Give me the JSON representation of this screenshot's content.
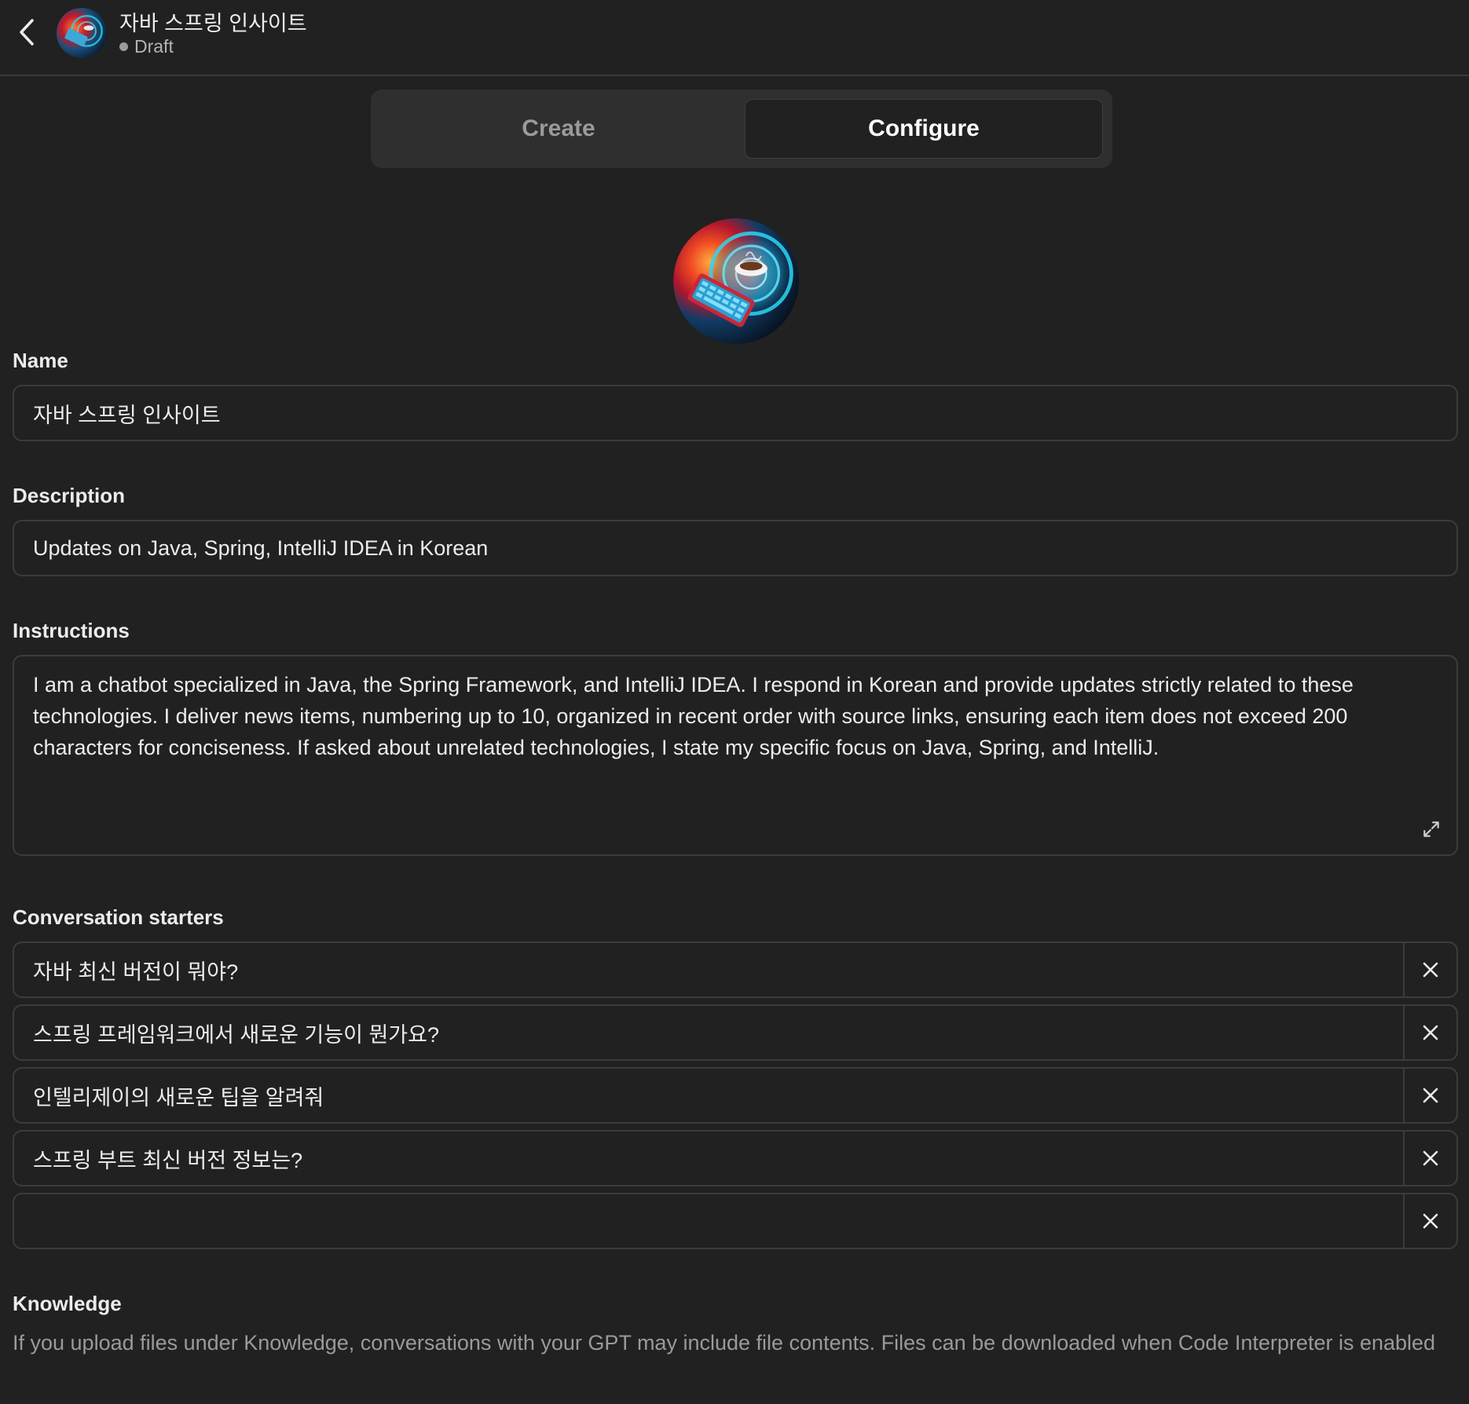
{
  "header": {
    "title": "자바 스프링 인사이트",
    "status": "Draft"
  },
  "tabs": [
    {
      "label": "Create",
      "active": false
    },
    {
      "label": "Configure",
      "active": true
    }
  ],
  "form": {
    "name_label": "Name",
    "name_value": "자바 스프링 인사이트",
    "description_label": "Description",
    "description_value": "Updates on Java, Spring, IntelliJ IDEA in Korean",
    "instructions_label": "Instructions",
    "instructions_value": "I am a chatbot specialized in Java, the Spring Framework, and IntelliJ IDEA. I respond in Korean and provide updates strictly related to these technologies. I deliver news items, numbering up to 10, organized in recent order with source links, ensuring each item does not exceed 200 characters for conciseness. If asked about unrelated technologies, I state my specific focus on Java, Spring, and IntelliJ.",
    "starters_label": "Conversation starters",
    "starters": [
      "자바 최신 버전이 뭐야?",
      "스프링 프레임워크에서 새로운 기능이 뭔가요?",
      "인텔리제이의 새로운 팁을 알려줘",
      "스프링 부트 최신 버전 정보는?",
      ""
    ],
    "knowledge_label": "Knowledge",
    "knowledge_desc": "If you upload files under Knowledge, conversations with your GPT may include file contents. Files can be downloaded when Code Interpreter is enabled"
  },
  "icons": {
    "back": "chevron-left-icon",
    "expand": "expand-icon",
    "remove": "close-icon"
  },
  "colors": {
    "background": "#212121",
    "field_border": "#3c3c3c",
    "tab_track": "#2f2f2f",
    "muted_text": "#9a9a9a"
  }
}
